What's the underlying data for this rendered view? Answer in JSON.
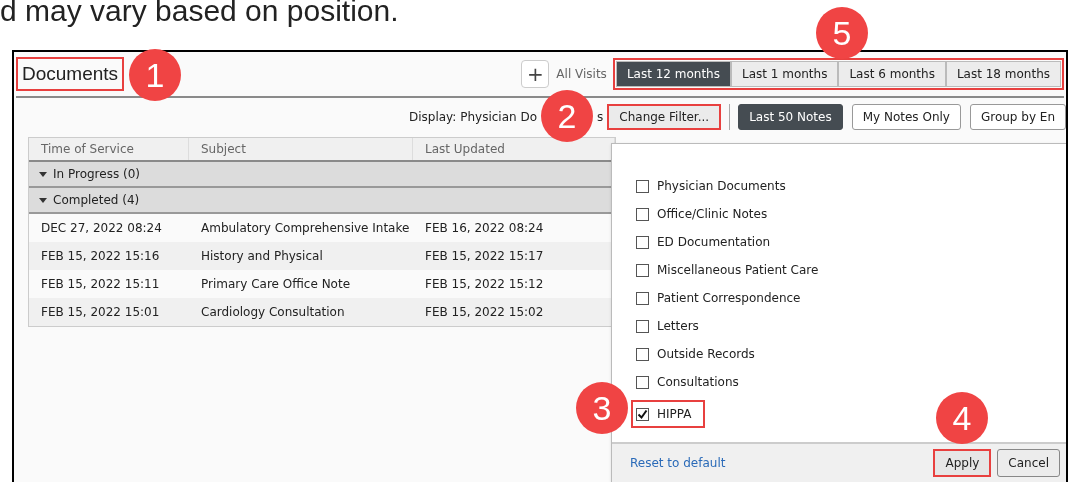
{
  "document_text": "d may vary based on position.",
  "header": {
    "title": "Documents",
    "title_highlighted": true,
    "add_button": "+",
    "all_visits": "All Visits",
    "range_tabs_highlighted": true,
    "range_tabs": [
      {
        "label": "Last 12 months",
        "selected": true
      },
      {
        "label": "Last 1 months",
        "selected": false
      },
      {
        "label": "Last 6 months",
        "selected": false
      },
      {
        "label": "Last 18 months",
        "selected": false
      }
    ]
  },
  "toolbar": {
    "display_parts": [
      "Display: Physician Do",
      "s"
    ],
    "change_filter": {
      "label": "Change Filter...",
      "highlighted": true
    },
    "toggles": [
      {
        "label": "Last 50 Notes",
        "selected": true
      },
      {
        "label": "My Notes Only",
        "selected": false
      },
      {
        "label": "Group by En",
        "selected": false
      }
    ]
  },
  "table": {
    "columns": [
      "Time of Service",
      "Subject",
      "Last Updated"
    ],
    "groups": [
      {
        "label": "In Progress (0)",
        "expanded": true
      },
      {
        "label": "Completed (4)",
        "expanded": true,
        "rows": [
          [
            "DEC 27, 2022 08:24",
            "Ambulatory Comprehensive Intake",
            "FEB 16, 2022 08:24"
          ],
          [
            "FEB 15, 2022 15:16",
            "History and Physical",
            "FEB 15, 2022 15:17"
          ],
          [
            "FEB 15, 2022 15:11",
            "Primary Care Office Note",
            "FEB 15, 2022 15:12"
          ],
          [
            "FEB 15, 2022 15:01",
            "Cardiology Consultation",
            "FEB 15, 2022 15:02"
          ]
        ]
      }
    ]
  },
  "filter_popup": {
    "options": [
      {
        "label": "Physician Documents",
        "checked": false,
        "highlighted": false
      },
      {
        "label": "Office/Clinic Notes",
        "checked": false,
        "highlighted": false
      },
      {
        "label": "ED Documentation",
        "checked": false,
        "highlighted": false
      },
      {
        "label": "Miscellaneous Patient Care",
        "checked": false,
        "highlighted": false
      },
      {
        "label": "Patient Correspondence",
        "checked": false,
        "highlighted": false
      },
      {
        "label": "Letters",
        "checked": false,
        "highlighted": false
      },
      {
        "label": "Outside Records",
        "checked": false,
        "highlighted": false
      },
      {
        "label": "Consultations",
        "checked": false,
        "highlighted": false
      },
      {
        "label": "HIPPA",
        "checked": true,
        "highlighted": true
      }
    ],
    "reset_link": "Reset to default",
    "apply": {
      "label": "Apply",
      "highlighted": true
    },
    "cancel": "Cancel"
  },
  "callouts": [
    {
      "label": "1"
    },
    {
      "label": "2"
    },
    {
      "label": "3"
    },
    {
      "label": "4"
    },
    {
      "label": "5"
    }
  ]
}
